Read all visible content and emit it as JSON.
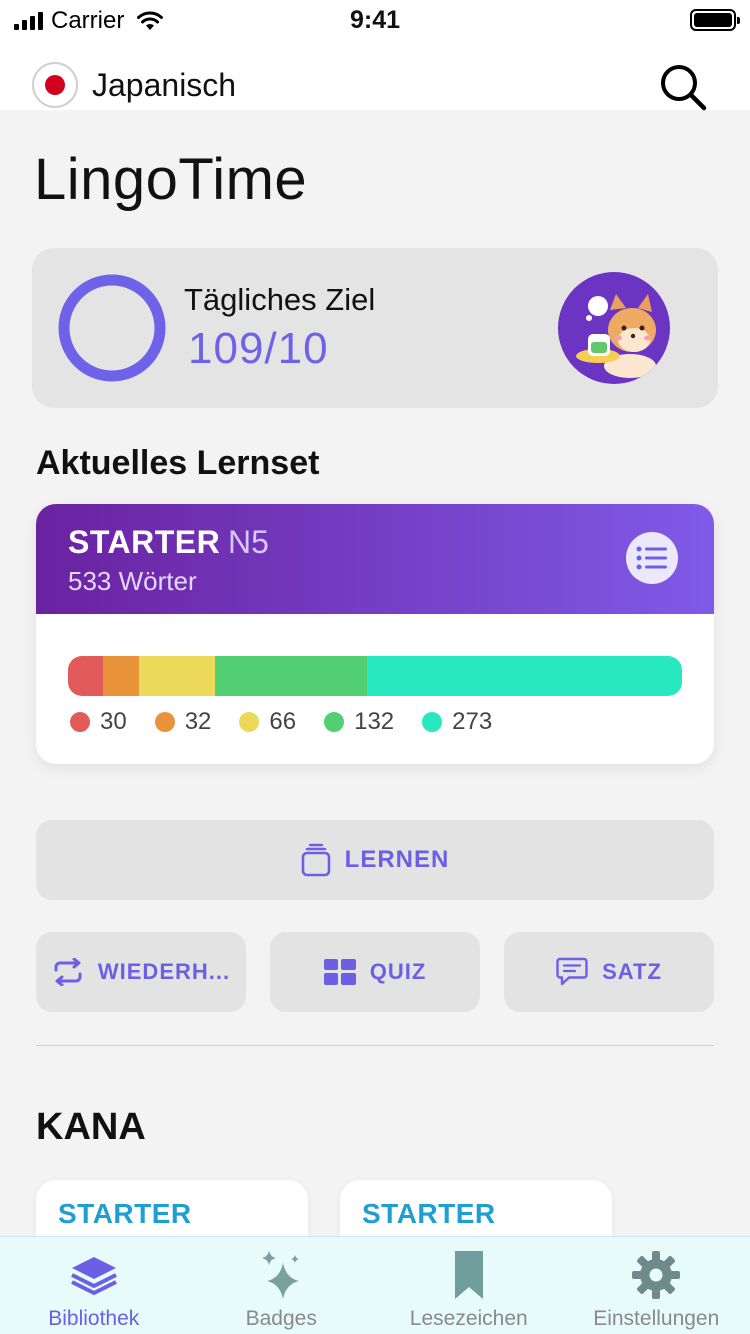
{
  "status_bar": {
    "carrier": "Carrier",
    "time": "9:41"
  },
  "header": {
    "language": "Japanisch",
    "flag_icon": "japan-flag-icon",
    "search_icon": "search-icon",
    "app_title": "LingoTime"
  },
  "daily_goal": {
    "label": "Tägliches Ziel",
    "value": "109/10",
    "ring_color": "#6e62e8"
  },
  "current_set": {
    "section_title": "Aktuelles Lernset",
    "name": "STARTER",
    "level": "N5",
    "word_count": "533 Wörter",
    "list_icon": "list-icon",
    "progress": [
      {
        "value": 30,
        "label": "30",
        "color": "#e25a5a"
      },
      {
        "value": 32,
        "label": "32",
        "color": "#e8923a"
      },
      {
        "value": 66,
        "label": "66",
        "color": "#ecd95a"
      },
      {
        "value": 132,
        "label": "132",
        "color": "#52cf72"
      },
      {
        "value": 273,
        "label": "273",
        "color": "#28e8c2"
      }
    ]
  },
  "actions": {
    "learn": "LERNEN",
    "review": "WIEDERH...",
    "quiz": "QUIZ",
    "sentence": "SATZ"
  },
  "kana": {
    "section_title": "KANA",
    "cards": [
      {
        "title": "STARTER"
      },
      {
        "title": "STARTER"
      }
    ]
  },
  "tab_bar": {
    "tabs": [
      {
        "label": "Bibliothek",
        "icon": "layers-icon",
        "active": true
      },
      {
        "label": "Badges",
        "icon": "sparkles-icon",
        "active": false
      },
      {
        "label": "Lesezeichen",
        "icon": "bookmark-icon",
        "active": false
      },
      {
        "label": "Einstellungen",
        "icon": "gear-icon",
        "active": false
      }
    ]
  },
  "colors": {
    "accent": "#6d5fe4",
    "kana_title": "#1f9ed1",
    "tab_bar_bg": "#e6fbfa"
  }
}
